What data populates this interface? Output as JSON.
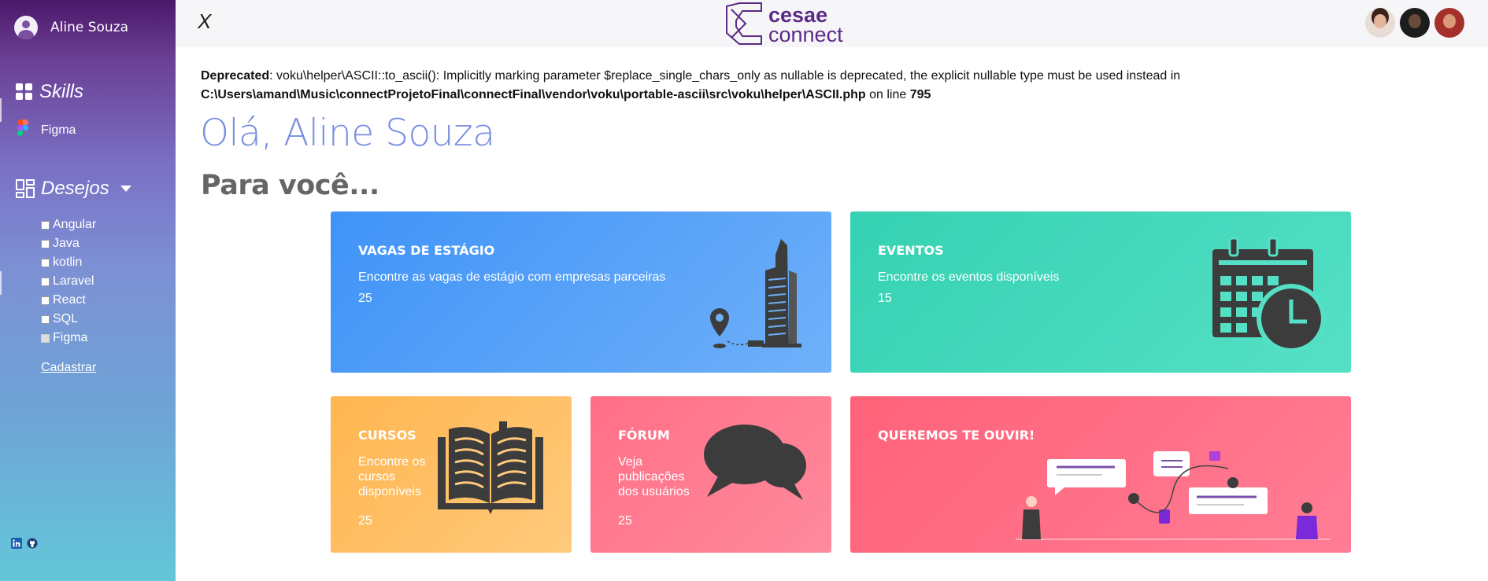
{
  "sidebar": {
    "user_name": "Aline Souza",
    "skills_title": "Skills",
    "skills": [
      {
        "label": "Figma"
      }
    ],
    "desejos_title": "Desejos",
    "wishlist": [
      {
        "label": "Angular",
        "checked": false
      },
      {
        "label": "Java",
        "checked": false
      },
      {
        "label": "kotlin",
        "checked": false
      },
      {
        "label": "Laravel",
        "checked": false
      },
      {
        "label": "React",
        "checked": false
      },
      {
        "label": "SQL",
        "checked": false
      },
      {
        "label": "Figma",
        "checked": false,
        "disabled": true
      }
    ],
    "cadastrar_label": "Cadastrar",
    "icons": [
      "linkedin-icon",
      "github-icon"
    ]
  },
  "topbar": {
    "close_label": "X",
    "logo_top": "cesae",
    "logo_bottom": "connect",
    "avatars": [
      "avatar-1",
      "avatar-2",
      "avatar-3"
    ]
  },
  "deprecation": {
    "label": "Deprecated",
    "message": ": voku\\helper\\ASCII::to_ascii(): Implicitly marking parameter $replace_single_chars_only as nullable is deprecated, the explicit nullable type must be used instead in",
    "path": "C:\\Users\\amand\\Music\\connectProjetoFinal\\connectFinal\\vendor\\voku\\portable-ascii\\src\\voku\\helper\\ASCII.php",
    "line_text": " on line ",
    "line_number": "795"
  },
  "main": {
    "greeting": "Olá, Aline Souza",
    "subtitle": "Para você..."
  },
  "cards": {
    "vagas": {
      "title": "VAGAS DE ESTÁGIO",
      "description": "Encontre as vagas de estágio com empresas parceiras",
      "count": "25"
    },
    "eventos": {
      "title": "EVENTOS",
      "description": "Encontre os eventos disponíveis",
      "count": "15"
    },
    "cursos": {
      "title": "CURSOS",
      "description": "Encontre os cursos disponíveis",
      "count": "25"
    },
    "forum": {
      "title": "FÓRUM",
      "description": "Veja publicações dos usuários",
      "count": "25"
    },
    "ouvir": {
      "title": "QUEREMOS TE OUVIR!"
    }
  },
  "colors": {
    "vagas": "#3f93f8",
    "eventos": "#35d1b2",
    "cursos": "#ffb54f",
    "forum": "#ff6f86",
    "ouvir": "#ff6279",
    "greeting": "#7a8ee0",
    "logo": "#5b2a86"
  }
}
